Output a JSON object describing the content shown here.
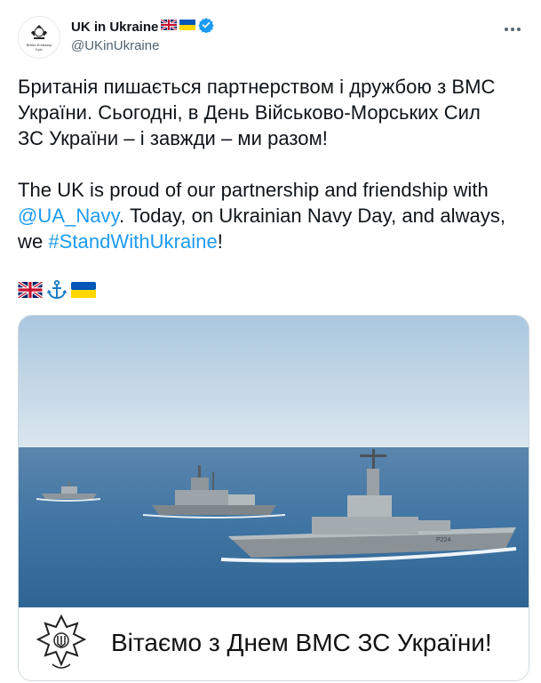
{
  "account": {
    "display_name": "UK in Ukraine",
    "handle": "@UKinUkraine",
    "avatar_caption": "British Embassy\nKyiv",
    "name_flags": [
      "uk-flag-icon",
      "ukraine-flag-icon"
    ],
    "verified": true
  },
  "tweet": {
    "ukrainian_line1": "Британія пишається партнерством і дружбою з ВМС",
    "ukrainian_line2": "України. Сьогодні, в День Військово-Морських Сил",
    "ukrainian_line3": "ЗС України – і завжди – ми разом!",
    "english_line1": "The UK is proud of our partnership and friendship with",
    "mention": "@UA_Navy",
    "english_line2_rest": ". Today, on Ukrainian Navy Day, and always,",
    "english_line3_prefix": "we ",
    "hashtag": "#StandWithUkraine",
    "english_line3_suffix": "!",
    "emojis": [
      "uk-flag-icon",
      "anchor-icon",
      "ukraine-flag-icon"
    ]
  },
  "media": {
    "banner_text": "Вітаємо з Днем ВМС ЗС України!",
    "hull_number": "P224"
  },
  "colors": {
    "link": "#1d9bf0",
    "text": "#0f1419",
    "secondary": "#536471",
    "sea": "#3f74a3",
    "sky": "#c9dcea"
  }
}
